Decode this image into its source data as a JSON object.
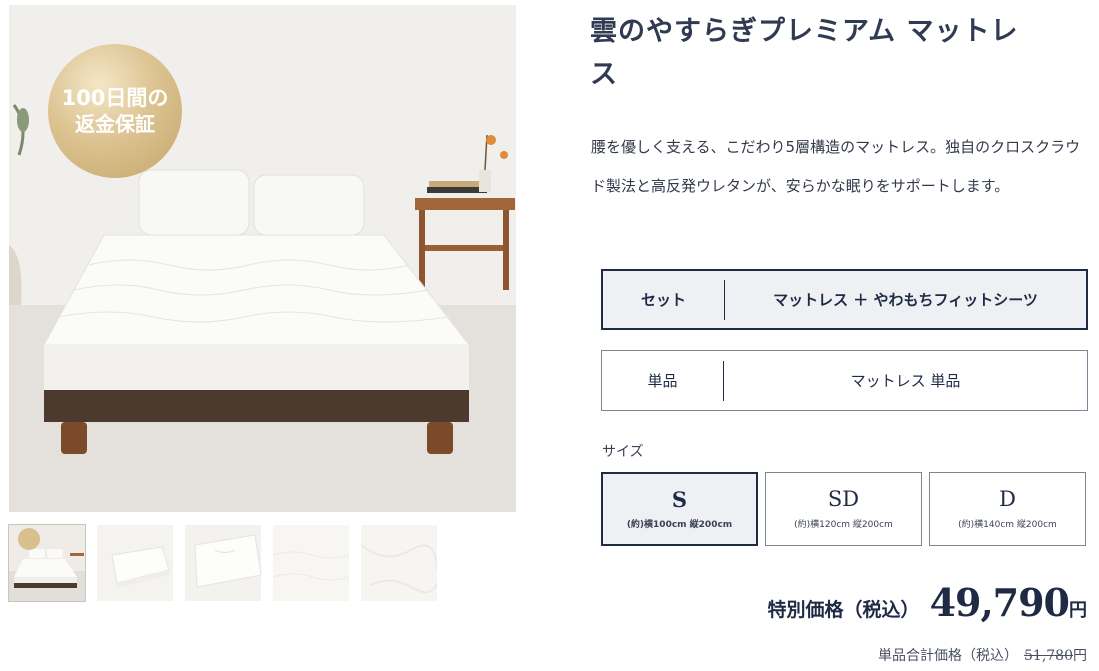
{
  "product": {
    "title": "雲のやすらぎプレミアム マットレス",
    "description": "腰を優しく支える、こだわり5層構造のマットレス。独自のクロスクラウド製法と高反発ウレタンが、安らかな眠りをサポートします。",
    "badge_line1": "100日間の",
    "badge_line2": "返金保証"
  },
  "options": [
    {
      "label": "セット",
      "value": "マットレス ＋ やわもちフィットシーツ",
      "selected": true
    },
    {
      "label": "単品",
      "value": "マットレス 単品",
      "selected": false
    }
  ],
  "size": {
    "label": "サイズ",
    "choices": [
      {
        "name": "S",
        "dims": "(約)横100cm 縦200cm",
        "selected": true
      },
      {
        "name": "SD",
        "dims": "(約)横120cm 縦200cm",
        "selected": false
      },
      {
        "name": "D",
        "dims": "(約)横140cm 縦200cm",
        "selected": false
      }
    ]
  },
  "price": {
    "label": "特別価格（税込）",
    "value": "49,790",
    "unit": "円",
    "original_label": "単品合計価格（税込）",
    "original_value": "51,780",
    "original_unit": "円"
  },
  "thumbnails": [
    "bed-room-photo",
    "mattress-top-photo",
    "mattress-angle-photo",
    "fabric-closeup-photo",
    "fabric-detail-photo"
  ],
  "colors": {
    "navy": "#1f2a44",
    "selected_bg": "#eef0f4",
    "gold": "#d4b77f"
  }
}
